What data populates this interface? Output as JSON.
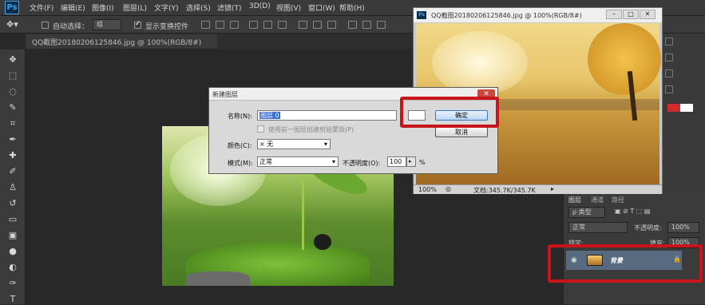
{
  "app": {
    "logo": "Ps"
  },
  "menu": [
    "文件(F)",
    "编辑(E)",
    "图像(I)",
    "图层(L)",
    "文字(Y)",
    "选择(S)",
    "滤镜(T)",
    "3D(D)",
    "视图(V)",
    "窗口(W)",
    "帮助(H)"
  ],
  "options": {
    "auto_select_label": "自动选择：",
    "auto_select_value": "组",
    "show_transform_label": "显示变换控件"
  },
  "doc_tab": "QQ截图20180206125846.jpg @ 100%(RGB/8#)",
  "dialog": {
    "title": "新建图层",
    "close": "✕",
    "name_label": "名称(N):",
    "name_value": "图层 0",
    "use_prev_label": "使用前一图层创建剪贴蒙版(P)",
    "color_label": "颜色(C):",
    "color_value": "× 无",
    "mode_label": "模式(M):",
    "mode_value": "正常",
    "opacity_label": "不透明度(O):",
    "opacity_value": "100",
    "opacity_unit": "%",
    "ok": "确定",
    "cancel": "取消"
  },
  "window2": {
    "title": "QQ截图20180206125846.jpg @ 100%(RGB/8#)",
    "zoom": "100%",
    "doc_size": "文档:345.7K/345.7K"
  },
  "layers": {
    "tabs": [
      "图层",
      "通道",
      "路径"
    ],
    "kind": "ρ 类型",
    "blend": "正常",
    "opacity_label": "不透明度:",
    "opacity_value": "100%",
    "lock_label": "锁定:",
    "fill_label": "填充:",
    "fill_value": "100%",
    "layer_name": "背景"
  },
  "colors": {
    "accent": "#c8151b",
    "selection": "#3a6fd8",
    "ps_blue": "#3da0e8"
  }
}
